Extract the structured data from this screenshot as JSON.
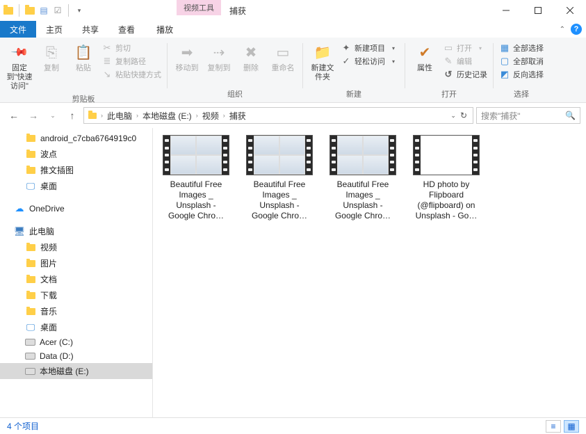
{
  "titlebar": {
    "context_tab": "视频工具",
    "title": "捕获"
  },
  "tabs": {
    "file": "文件",
    "home": "主页",
    "share": "共享",
    "view": "查看",
    "play": "播放"
  },
  "ribbon": {
    "pin": "固定到\"快速访问\"",
    "copy": "复制",
    "paste": "粘贴",
    "cut": "剪切",
    "copy_path": "复制路径",
    "paste_shortcut": "粘贴快捷方式",
    "group_clipboard": "剪贴板",
    "move_to": "移动到",
    "copy_to": "复制到",
    "delete": "删除",
    "rename": "重命名",
    "group_organize": "组织",
    "new_folder": "新建文件夹",
    "new_item": "新建项目",
    "easy_access": "轻松访问",
    "group_new": "新建",
    "properties": "属性",
    "open": "打开",
    "edit": "编辑",
    "history": "历史记录",
    "group_open": "打开",
    "select_all": "全部选择",
    "select_none": "全部取消",
    "invert_selection": "反向选择",
    "group_select": "选择"
  },
  "nav": {
    "crumbs": [
      "此电脑",
      "本地磁盘 (E:)",
      "视频",
      "捕获"
    ],
    "search_placeholder": "搜索\"捕获\""
  },
  "tree": {
    "quick": [
      {
        "label": "android_c7cba6764919c0",
        "type": "folder"
      },
      {
        "label": "波点",
        "type": "folder"
      },
      {
        "label": "推文插图",
        "type": "folder"
      },
      {
        "label": "桌面",
        "type": "desktop"
      }
    ],
    "onedrive": "OneDrive",
    "this_pc": "此电脑",
    "pc_children": [
      {
        "label": "视频",
        "type": "lib"
      },
      {
        "label": "图片",
        "type": "lib"
      },
      {
        "label": "文档",
        "type": "lib"
      },
      {
        "label": "下载",
        "type": "lib"
      },
      {
        "label": "音乐",
        "type": "lib"
      },
      {
        "label": "桌面",
        "type": "desktop"
      },
      {
        "label": "Acer (C:)",
        "type": "drive"
      },
      {
        "label": "Data (D:)",
        "type": "drive"
      },
      {
        "label": "本地磁盘 (E:)",
        "type": "drive",
        "selected": true
      }
    ]
  },
  "files": [
    {
      "name": "Beautiful Free Images _ Unsplash - Google Chro…",
      "thumb": "grid"
    },
    {
      "name": "Beautiful Free Images _ Unsplash - Google Chro…",
      "thumb": "grid"
    },
    {
      "name": "Beautiful Free Images _ Unsplash - Google Chro…",
      "thumb": "grid"
    },
    {
      "name": "HD photo by Flipboard (@flipboard) on Unsplash - Go…",
      "thumb": "light"
    }
  ],
  "status": {
    "count": "4 个项目"
  }
}
